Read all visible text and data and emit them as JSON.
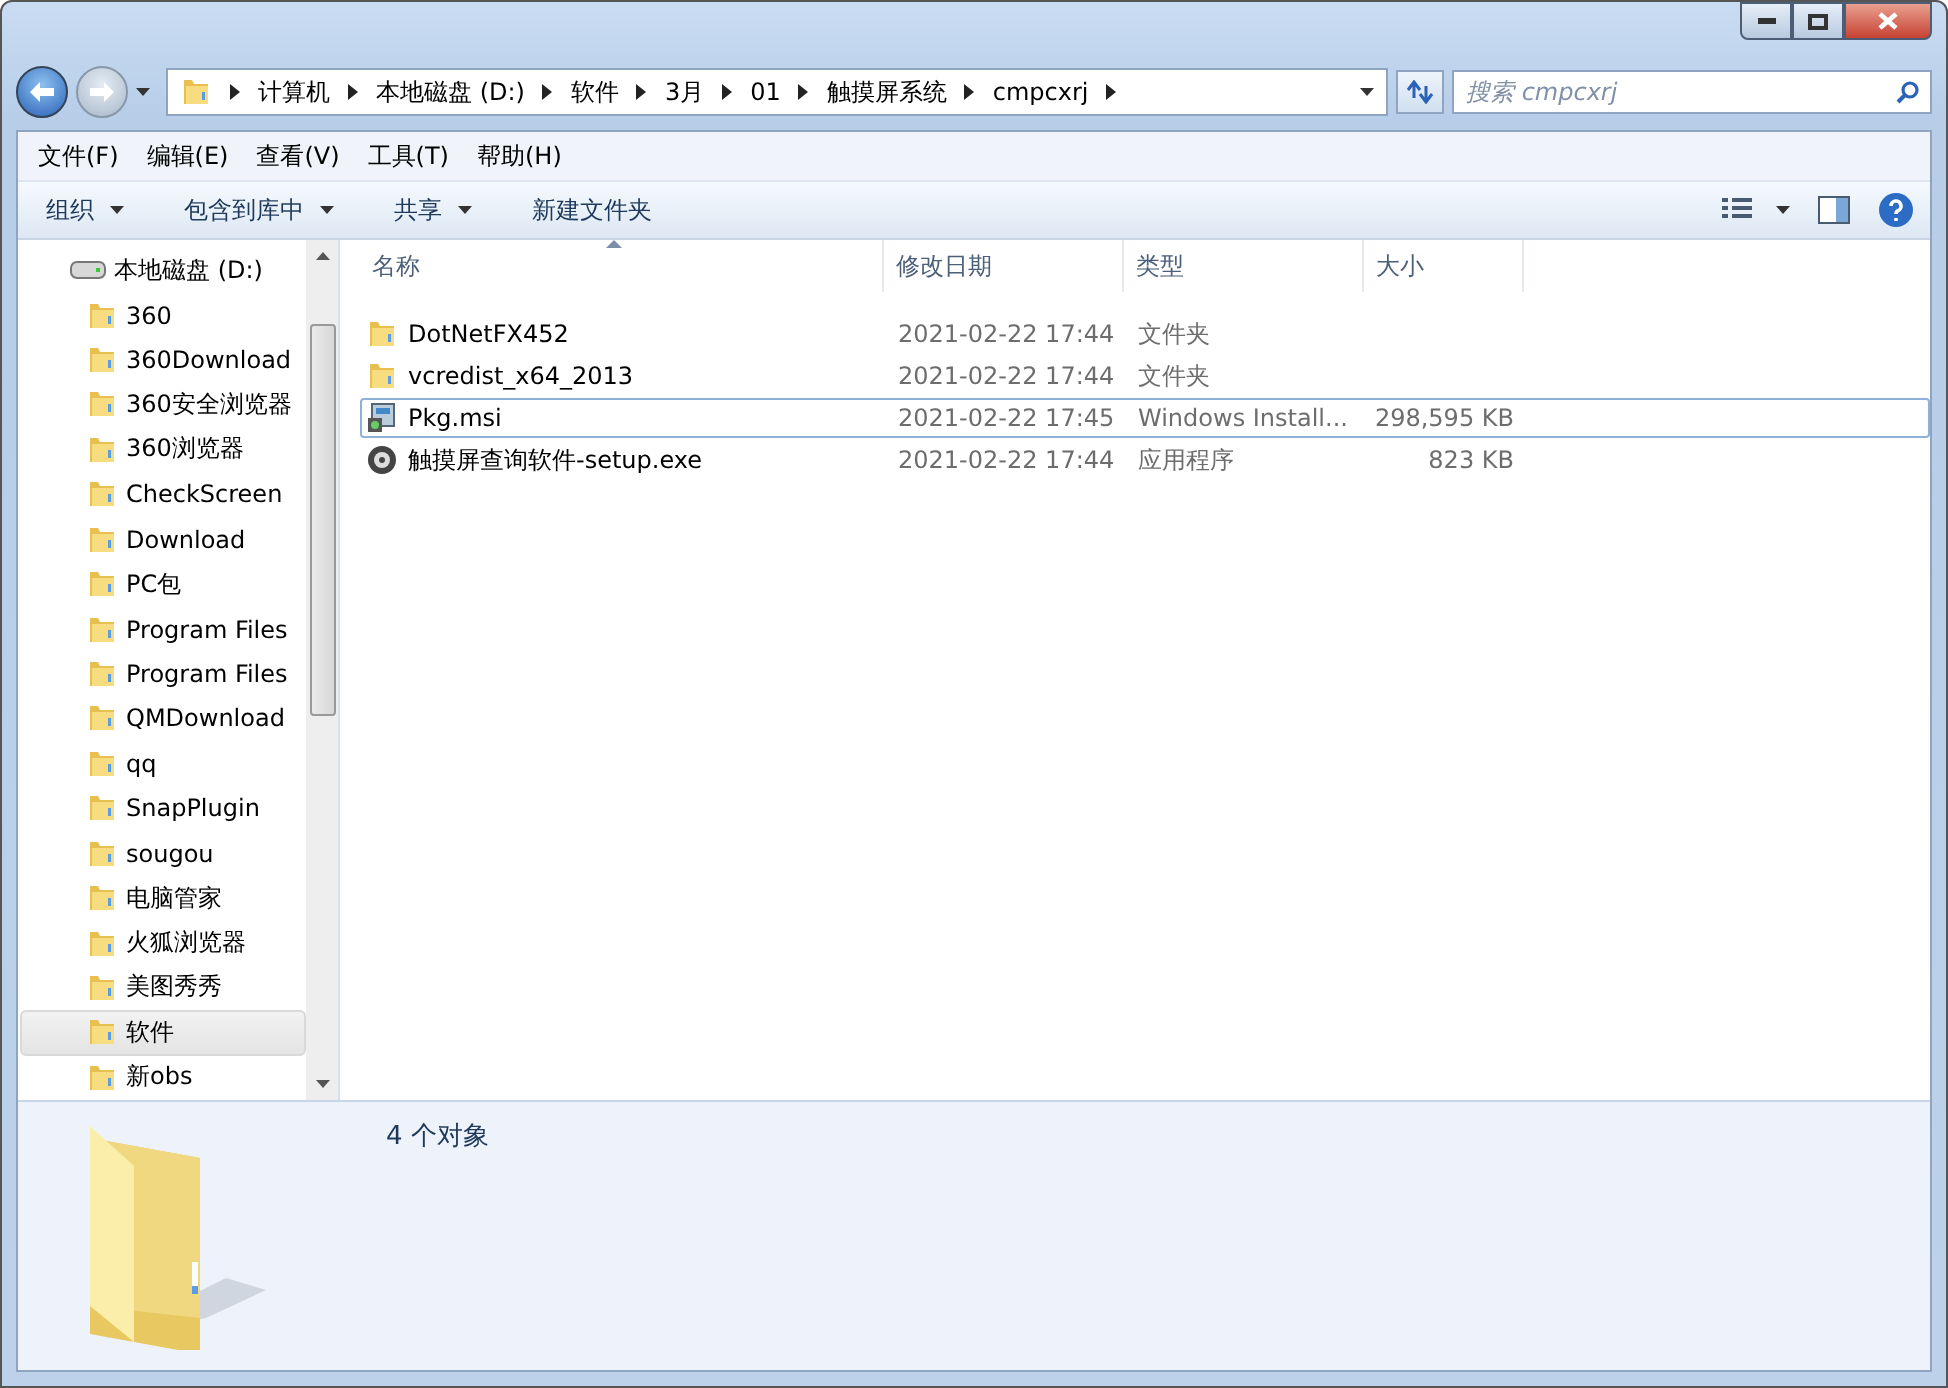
{
  "address": {
    "crumbs": [
      "计算机",
      "本地磁盘 (D:)",
      "软件",
      "3月",
      "01",
      "触摸屏系统",
      "cmpcxrj"
    ]
  },
  "search": {
    "placeholder": "搜索 cmpcxrj"
  },
  "menu": [
    "文件(F)",
    "编辑(E)",
    "查看(V)",
    "工具(T)",
    "帮助(H)"
  ],
  "commands": [
    {
      "label": "组织",
      "dropdown": true
    },
    {
      "label": "包含到库中",
      "dropdown": true
    },
    {
      "label": "共享",
      "dropdown": true
    },
    {
      "label": "新建文件夹",
      "dropdown": false
    }
  ],
  "nav": {
    "items": [
      {
        "label": "本地磁盘 (D:)",
        "kind": "drive",
        "selected": false,
        "children": [
          {
            "label": "360",
            "kind": "folder",
            "selected": false
          },
          {
            "label": "360Download",
            "kind": "folder",
            "selected": false
          },
          {
            "label": "360安全浏览器",
            "kind": "folder",
            "selected": false
          },
          {
            "label": "360浏览器",
            "kind": "folder",
            "selected": false
          },
          {
            "label": "CheckScreen",
            "kind": "folder",
            "selected": false
          },
          {
            "label": "Download",
            "kind": "folder",
            "selected": false
          },
          {
            "label": "PC包",
            "kind": "folder",
            "selected": false
          },
          {
            "label": "Program Files",
            "kind": "folder",
            "selected": false
          },
          {
            "label": "Program Files",
            "kind": "folder",
            "selected": false
          },
          {
            "label": "QMDownload",
            "kind": "folder",
            "selected": false
          },
          {
            "label": "qq",
            "kind": "folder",
            "selected": false
          },
          {
            "label": "SnapPlugin",
            "kind": "folder",
            "selected": false
          },
          {
            "label": "sougou",
            "kind": "folder",
            "selected": false
          },
          {
            "label": "电脑管家",
            "kind": "folder",
            "selected": false
          },
          {
            "label": "火狐浏览器",
            "kind": "folder",
            "selected": false
          },
          {
            "label": "美图秀秀",
            "kind": "folder",
            "selected": false
          },
          {
            "label": "软件",
            "kind": "folder",
            "selected": true
          },
          {
            "label": "新obs",
            "kind": "folder",
            "selected": false
          }
        ]
      }
    ]
  },
  "table": {
    "columns": [
      "名称",
      "修改日期",
      "类型",
      "大小"
    ],
    "rows": [
      {
        "kind": "folder",
        "name": "DotNetFX452",
        "date": "2021-02-22 17:44",
        "type": "文件夹",
        "focused": false
      },
      {
        "kind": "folder",
        "name": "vcredist_x64_2013",
        "date": "2021-02-22 17:44",
        "type": "文件夹",
        "focused": false
      },
      {
        "kind": "installer",
        "name": "Pkg.msi",
        "date": "2021-02-22 17:45",
        "type": "Windows Install...",
        "size": "298,595 KB",
        "focused": true
      },
      {
        "kind": "program",
        "name": "触摸屏查询软件-setup.exe",
        "date": "2021-02-22 17:44",
        "type": "应用程序",
        "size": "823 KB",
        "focused": false
      }
    ]
  },
  "details": {
    "summary": "4 个对象"
  }
}
